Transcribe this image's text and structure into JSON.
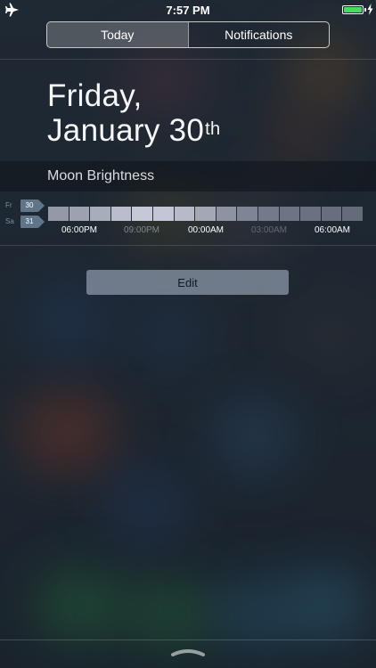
{
  "status_bar": {
    "time": "7:57 PM",
    "airplane_icon": "airplane-icon",
    "battery_icon": "battery-icon",
    "charging_icon": "bolt-icon"
  },
  "segmented_control": {
    "tabs": [
      {
        "label": "Today",
        "active": true
      },
      {
        "label": "Notifications",
        "active": false
      }
    ]
  },
  "date": {
    "line1": "Friday,",
    "line2": "January 30",
    "suffix": "th"
  },
  "widget": {
    "title": "Moon Brightness",
    "days": [
      {
        "name": "Fr",
        "num": "30"
      },
      {
        "name": "Sa",
        "num": "31"
      }
    ],
    "brightness": [
      0.52,
      0.58,
      0.66,
      0.78,
      0.86,
      0.84,
      0.76,
      0.62,
      0.48,
      0.38,
      0.3,
      0.26,
      0.24,
      0.22,
      0.2
    ],
    "time_labels": [
      "06:00PM",
      "09:00PM",
      "00:00AM",
      "03:00AM",
      "06:00AM"
    ],
    "edit_label": "Edit"
  },
  "colors": {
    "battery": "#4cd964",
    "day_tag": "#607588"
  }
}
